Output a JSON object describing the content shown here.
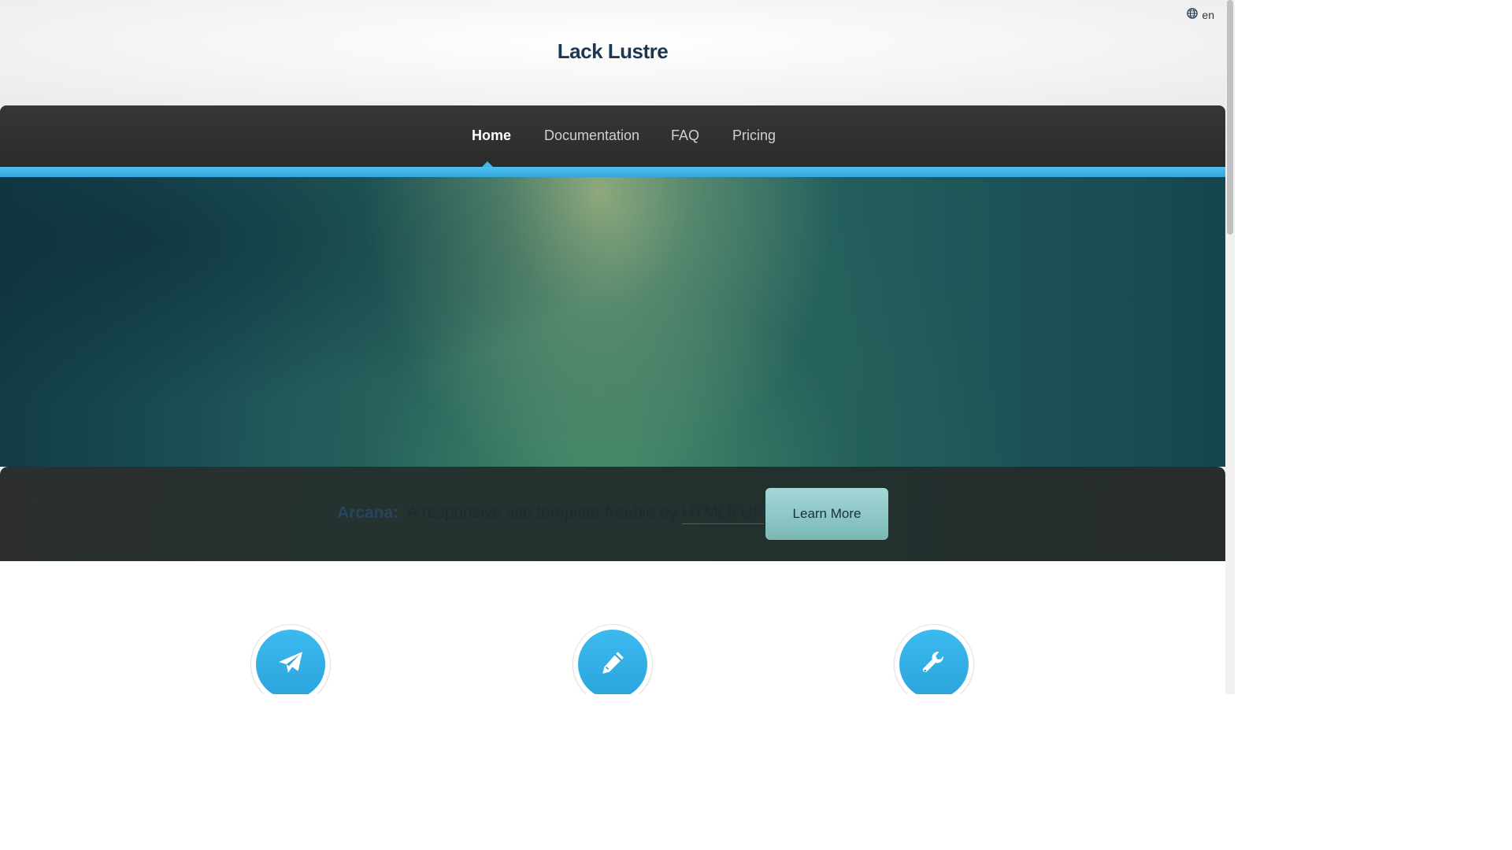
{
  "header": {
    "site_title": "Lack Lustre",
    "language": "en",
    "language_icon": "globe-icon"
  },
  "nav": {
    "items": [
      {
        "label": "Home",
        "active": true
      },
      {
        "label": "Documentation",
        "active": false
      },
      {
        "label": "FAQ",
        "active": false
      },
      {
        "label": "Pricing",
        "active": false
      }
    ]
  },
  "banner": {
    "brand": "Arcana:",
    "text": "A responsive site template freebie by",
    "link": "HTML5 UP",
    "button_label": "Learn More"
  },
  "features": [
    {
      "icon": "paper-plane-icon"
    },
    {
      "icon": "pencil-icon"
    },
    {
      "icon": "wrench-icon"
    }
  ],
  "colors": {
    "accent": "#43b5ec",
    "nav_bg": "#2e2e2e",
    "title": "#1f3650",
    "button": "#8cc7c5"
  }
}
